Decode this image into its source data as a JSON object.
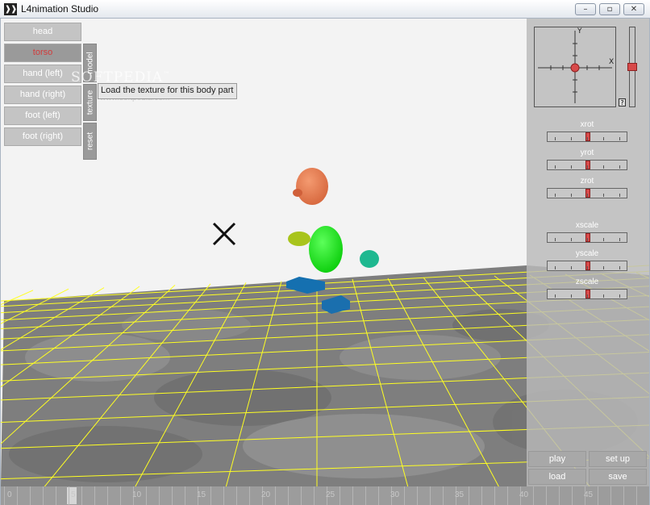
{
  "window": {
    "icon": "❱❱",
    "title": "L4nimation Studio",
    "minimize_icon": "–",
    "maximize_icon": "▫",
    "close_icon": "✕"
  },
  "body_parts": [
    {
      "label": "head",
      "active": false
    },
    {
      "label": "torso",
      "active": true
    },
    {
      "label": "hand (left)",
      "active": false
    },
    {
      "label": "hand (right)",
      "active": false
    },
    {
      "label": "foot (left)",
      "active": false
    },
    {
      "label": "foot (right)",
      "active": false
    }
  ],
  "side_buttons": {
    "model": "model",
    "texture": "texture",
    "reset": "reset"
  },
  "tooltip": "Load the texture for this body part",
  "watermark": {
    "main": "SOFTPEDIA",
    "tm": "™",
    "url": "www.softpedia.com"
  },
  "coord_view": {
    "y_label": "Y",
    "x_label": "X",
    "help": "?"
  },
  "sliders": [
    {
      "label": "xrot",
      "value": 0.5
    },
    {
      "label": "yrot",
      "value": 0.5
    },
    {
      "label": "zrot",
      "value": 0.5
    },
    {
      "label": "xscale",
      "value": 0.5
    },
    {
      "label": "yscale",
      "value": 0.5
    },
    {
      "label": "zscale",
      "value": 0.5
    }
  ],
  "controls": {
    "play": "play",
    "set_up": "set up",
    "load": "load",
    "save": "save"
  },
  "timeline": {
    "labels": [
      "0",
      "5",
      "10",
      "15",
      "20",
      "25",
      "30",
      "35",
      "40",
      "45"
    ],
    "current_frame": 5
  },
  "colors": {
    "head": "#e87b50",
    "torso": "#22ee1c",
    "hand_left": "#a8c41c",
    "hand_right": "#1fb890",
    "foot_left": "#1570b0",
    "foot_right": "#1a6fae",
    "grid": "#ffff22",
    "slider_thumb": "#d84a4a"
  }
}
